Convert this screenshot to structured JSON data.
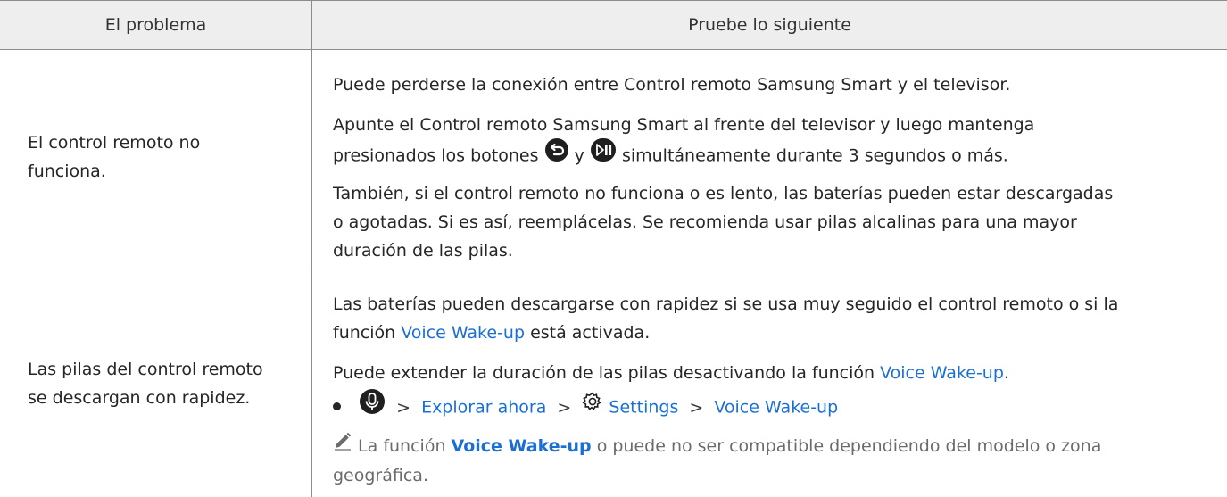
{
  "header": {
    "col1": "El problema",
    "col2": "Pruebe lo siguiente"
  },
  "row1": {
    "problem_line1": "El control remoto no",
    "problem_line2": "funciona.",
    "p1": "Puede perderse la conexión entre Control remoto Samsung Smart y el televisor.",
    "p2_line1": "Apunte el Control remoto Samsung Smart al frente del televisor y luego mantenga",
    "p2_line2_a": "presionados los botones",
    "p2_line2_b": "y",
    "p2_line2_c": "simultáneamente durante 3 segundos o más.",
    "p3_line1": "También, si el control remoto no funciona o es lento, las baterías pueden estar descargadas",
    "p3_line2": "o agotadas. Si es así, reemplácelas. Se recomienda usar pilas alcalinas para una mayor",
    "p3_line3": "duración de las pilas."
  },
  "row2": {
    "problem_line1": "Las pilas del control remoto",
    "problem_line2": "se descargan con rapidez.",
    "p1_line1": "Las baterías pueden descargarse con rapidez si se usa muy seguido el control remoto o si la",
    "p1_line2_a": "función",
    "p1_line2_link": "Voice Wake-up",
    "p1_line2_b": "está activada.",
    "p2_a": "Puede extender la duración de las pilas desactivando la función",
    "p2_link": "Voice Wake-up",
    "p2_b": ".",
    "path": {
      "item1": "Explorar ahora",
      "item2": "Settings",
      "item3": "Voice Wake-up",
      "separator": ">"
    },
    "note_line1_a": "La función",
    "note_line1_link": "Voice Wake-up",
    "note_line1_b": "o puede no ser compatible dependiendo del modelo o zona",
    "note_line2": "geográfica."
  },
  "colors": {
    "link": "#1a6fd6",
    "header_bg": "#eeeeee",
    "border": "#8c8c8c",
    "note_text": "#6b6b6b"
  },
  "icons": [
    "return-button-icon",
    "play-pause-button-icon",
    "microphone-button-icon",
    "settings-gear-icon",
    "note-pencil-icon"
  ]
}
